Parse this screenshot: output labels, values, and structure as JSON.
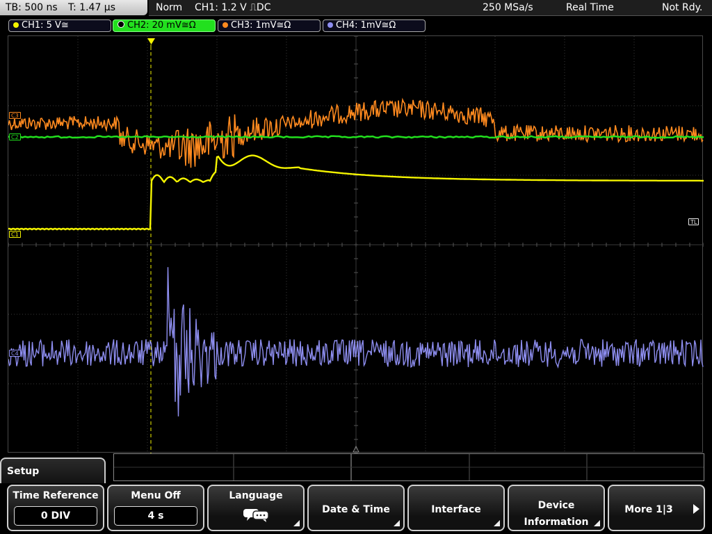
{
  "topbar": {
    "timebase": "TB: 500 ns",
    "trigger_time": "T: 1.47 µs",
    "mode": "Norm",
    "trigger": "CH1: 1.2 V ⎍DC",
    "sample_rate": "250 MSa/s",
    "acq_mode": "Real Time",
    "status": "Not Rdy."
  },
  "channels": [
    {
      "label": "CH1: 5 V≅",
      "color": "#f5f500",
      "active": false
    },
    {
      "label": "CH2: 20 mV≅Ω",
      "color": "#22e01e",
      "active": true
    },
    {
      "label": "CH3: 1mV≅Ω",
      "color": "#ff8a1f",
      "active": false
    },
    {
      "label": "CH4: 1mV≅Ω",
      "color": "#8e8ef0",
      "active": false
    }
  ],
  "markers": {
    "trigger_level": "TL",
    "ch1": "C1",
    "ch2": "C2",
    "ch3": "C3",
    "ch4": "C4"
  },
  "menu": {
    "title": "Setup",
    "softkeys": [
      {
        "label": "Time Reference",
        "value": "0 DIV"
      },
      {
        "label": "Menu Off",
        "value": "4 s"
      },
      {
        "label": "Language",
        "icon": "speech-bubbles-icon"
      },
      {
        "label": "Date & Time"
      },
      {
        "label": "Interface"
      },
      {
        "label": "Device",
        "label2": "Information"
      },
      {
        "label": "More 1|3"
      }
    ]
  },
  "colors": {
    "ch1": "#f5f500",
    "ch2": "#22e01e",
    "ch3": "#ff8a1f",
    "ch4": "#8e8ef0",
    "grid": "#3a3a3a"
  }
}
